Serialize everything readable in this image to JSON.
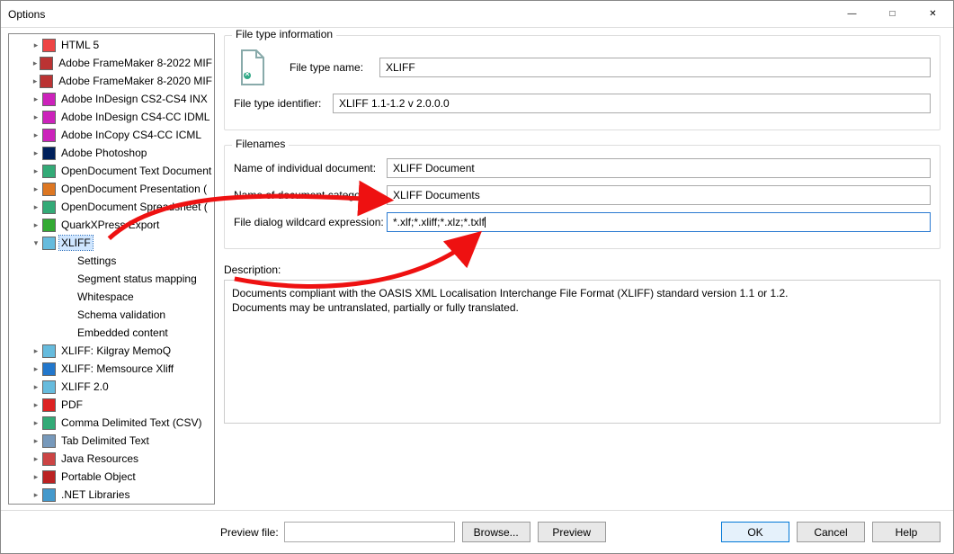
{
  "window": {
    "title": "Options"
  },
  "tree": {
    "items": [
      {
        "depth": 1,
        "arrow": ">",
        "icon": "html5",
        "label": "HTML 5"
      },
      {
        "depth": 1,
        "arrow": ">",
        "icon": "fm",
        "label": "Adobe FrameMaker 8-2022 MIF"
      },
      {
        "depth": 1,
        "arrow": ">",
        "icon": "fm2020",
        "label": "Adobe FrameMaker 8-2020 MIF"
      },
      {
        "depth": 1,
        "arrow": ">",
        "icon": "inx",
        "label": "Adobe InDesign CS2-CS4 INX"
      },
      {
        "depth": 1,
        "arrow": ">",
        "icon": "idml",
        "label": "Adobe InDesign CS4-CC IDML"
      },
      {
        "depth": 1,
        "arrow": ">",
        "icon": "icml",
        "label": "Adobe InCopy CS4-CC ICML"
      },
      {
        "depth": 1,
        "arrow": ">",
        "icon": "ps",
        "label": "Adobe Photoshop"
      },
      {
        "depth": 1,
        "arrow": ">",
        "icon": "odt",
        "label": "OpenDocument Text Document"
      },
      {
        "depth": 1,
        "arrow": ">",
        "icon": "odp",
        "label": "OpenDocument Presentation ("
      },
      {
        "depth": 1,
        "arrow": ">",
        "icon": "ods",
        "label": "OpenDocument Spreadsheet ("
      },
      {
        "depth": 1,
        "arrow": ">",
        "icon": "qxp",
        "label": "QuarkXPress Export"
      },
      {
        "depth": 1,
        "arrow": "v",
        "icon": "xliff",
        "label": "XLIFF",
        "selected": true
      },
      {
        "depth": 2,
        "arrow": "",
        "icon": "",
        "label": "Settings"
      },
      {
        "depth": 2,
        "arrow": "",
        "icon": "",
        "label": "Segment status mapping"
      },
      {
        "depth": 2,
        "arrow": "",
        "icon": "",
        "label": "Whitespace"
      },
      {
        "depth": 2,
        "arrow": "",
        "icon": "",
        "label": "Schema validation"
      },
      {
        "depth": 2,
        "arrow": "",
        "icon": "",
        "label": "Embedded content"
      },
      {
        "depth": 1,
        "arrow": ">",
        "icon": "kilgray",
        "label": "XLIFF: Kilgray MemoQ"
      },
      {
        "depth": 1,
        "arrow": ">",
        "icon": "memsource",
        "label": "XLIFF: Memsource Xliff"
      },
      {
        "depth": 1,
        "arrow": ">",
        "icon": "xliff2",
        "label": "XLIFF 2.0"
      },
      {
        "depth": 1,
        "arrow": ">",
        "icon": "pdf",
        "label": "PDF"
      },
      {
        "depth": 1,
        "arrow": ">",
        "icon": "csv",
        "label": "Comma Delimited Text (CSV)"
      },
      {
        "depth": 1,
        "arrow": ">",
        "icon": "tab",
        "label": "Tab Delimited Text"
      },
      {
        "depth": 1,
        "arrow": ">",
        "icon": "java",
        "label": "Java Resources"
      },
      {
        "depth": 1,
        "arrow": ">",
        "icon": "po",
        "label": "Portable Object"
      },
      {
        "depth": 1,
        "arrow": ">",
        "icon": "net",
        "label": ".NET Libraries"
      }
    ]
  },
  "info": {
    "group_title": "File type information",
    "name_label": "File type name:",
    "name_value": "XLIFF",
    "id_label": "File type identifier:",
    "id_value": "XLIFF 1.1-1.2 v 2.0.0.0"
  },
  "filenames": {
    "group_title": "Filenames",
    "doc_label": "Name of individual document:",
    "doc_value": "XLIFF Document",
    "cat_label": "Name of document category:",
    "cat_value": "XLIFF Documents",
    "wc_label": "File dialog wildcard expression:",
    "wc_value": "*.xlf;*.xliff;*.xlz;*.txlf"
  },
  "description": {
    "label": "Description:",
    "line1": "Documents compliant with the OASIS XML Localisation Interchange File Format (XLIFF) standard version 1.1 or 1.2.",
    "line2": "Documents may be untranslated, partially or fully translated."
  },
  "footer": {
    "preview_label": "Preview file:",
    "preview_value": "",
    "browse": "Browse...",
    "preview": "Preview",
    "ok": "OK",
    "cancel": "Cancel",
    "help": "Help"
  }
}
